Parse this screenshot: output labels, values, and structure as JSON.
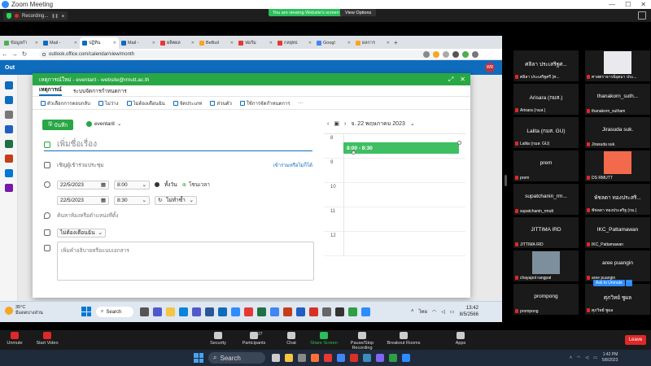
{
  "zoom": {
    "window_title": "Zoom Meeting",
    "recording_label": "Recording...",
    "share_banner": "You are viewing Website's screen",
    "view_options": "View Options",
    "controls": [
      {
        "label": "Unmute",
        "icon": "mic-muted-icon"
      },
      {
        "label": "Start Video",
        "icon": "video-off-icon"
      },
      {
        "label": "Security",
        "icon": "shield-icon"
      },
      {
        "label": "Participants",
        "icon": "participants-icon",
        "count": "27"
      },
      {
        "label": "Chat",
        "icon": "chat-icon"
      },
      {
        "label": "Share Screen",
        "icon": "share-screen-icon"
      },
      {
        "label": "Pause/Stop Recording",
        "icon": "record-icon"
      },
      {
        "label": "Breakout Rooms",
        "icon": "breakout-icon"
      },
      {
        "label": "Apps",
        "icon": "apps-icon"
      }
    ],
    "leave_label": "Leave",
    "ask_unmute": "Ask to Unmute",
    "ask_more": "···"
  },
  "participants": [
    {
      "name": "ศลิลา ประเสริฐศ...",
      "label": "ศลิลา ประเสริฐศรี (ศ...",
      "video": false
    },
    {
      "name": "",
      "label": "ศาสตราจารย์อุตมา ประ...",
      "video": true,
      "video_bg": "#e9e9ee"
    },
    {
      "name": "Arisara (กมส.)",
      "label": "Arisara (กมส.)",
      "video": false
    },
    {
      "name": "thanakorn_suth...",
      "label": "thanakorn_sutham",
      "video": false
    },
    {
      "name": "Lalita (กมส. GU)",
      "label": "Lalita (กมส. GU)",
      "video": false
    },
    {
      "name": "Jirasuda suk.",
      "label": "Jirasuda suk.",
      "video": false
    },
    {
      "name": "prem",
      "label": "prem",
      "video": false
    },
    {
      "name": "",
      "label": "DS RMUTT",
      "video": true,
      "video_bg": "#f26a4b"
    },
    {
      "name": "supatchanin_rm...",
      "label": "supatchanin_rmutt",
      "video": false
    },
    {
      "name": "พัชลดา ทองประสริ...",
      "label": "พัชลดา ทองประสริฐ (กม.)",
      "video": false
    },
    {
      "name": "JITTIMA IRD",
      "label": "JITTIMA IRD",
      "video": false
    },
    {
      "name": "IKC_Pattamawan",
      "label": "IKC_Pattamawan",
      "video": false
    },
    {
      "name": "",
      "label": "chayapol rangpat",
      "video": true,
      "video_bg": "#7d8f9c"
    },
    {
      "name": "aree puangin",
      "label": "aree puangin",
      "video": false
    },
    {
      "name": "prompong",
      "label": "prompong",
      "video": false
    },
    {
      "name": "ศุภวิทย์ ชูผล",
      "label": "ศุภวิทย์ ชูผล",
      "video": false
    }
  ],
  "browser": {
    "tabs": [
      {
        "label": "ข้อมูลกำ",
        "color": "#4caf50",
        "active": false
      },
      {
        "label": "Mail -",
        "color": "#0f6cbd",
        "active": false
      },
      {
        "label": "ปฏิทิน",
        "color": "#0f6cbd",
        "active": true
      },
      {
        "label": "Mail -",
        "color": "#0f6cbd",
        "active": false
      },
      {
        "label": "ผลิตผล",
        "color": "#e53935",
        "active": false
      },
      {
        "label": "BeBuil",
        "color": "#f5a623",
        "active": false
      },
      {
        "label": "ฟอร์ม",
        "color": "#e53935",
        "active": false
      },
      {
        "label": "กลยุทธ",
        "color": "#e53935",
        "active": false
      },
      {
        "label": "Googl",
        "color": "#4285f4",
        "active": false
      },
      {
        "label": "ผลการ",
        "color": "#f5a623",
        "active": false
      }
    ],
    "url": "outlook.office.com/calendar/view/month",
    "header_label": "Out",
    "avatar_initials": "WR"
  },
  "event": {
    "title_bar": "เหตุการณ์ใหม่ - eventarit - website@rmutt.ac.th",
    "tabs": [
      "เหตุการณ์",
      "ระบบจัดการกำหนดการ"
    ],
    "toolbar": [
      "ตัวเลือกการตอบกลับ",
      "ไม่ว่าง",
      "ไม่ต้องเตือนฉัน",
      "จัดประเภท",
      "ส่วนตัว",
      "ใช้การจัดกำหนดการ",
      "···"
    ],
    "save_label": "บันทึก",
    "calendar_name": "eventarit",
    "title_placeholder": "เพิ่มชื่อเรื่อง",
    "attendees_placeholder": "เชิญผู้เข้าร่วมประชุม",
    "attendees_optional": "เข้าร่วมหรือไม่ก็ได้",
    "start_date": "22/5/2023",
    "start_time": "8:00",
    "end_date": "22/5/2023",
    "end_time": "8:30",
    "all_day": "ทั้งวัน",
    "timezone": "โซนเวลา",
    "repeat": "ไม่ทำซ้ำ",
    "location_placeholder": "ค้นหาห้องหรือตำแหน่งที่ตั้ง",
    "reminder": "ไม่ต้องเตือนฉัน",
    "description_placeholder": "เพิ่มคำอธิบายหรือแนบเอกสาร"
  },
  "dayview": {
    "date_label": "จ. 22 พฤษภาคม 2023",
    "hours": [
      "8",
      "9",
      "10",
      "11",
      "12"
    ],
    "event_label": "8:00 - 8:30"
  },
  "shared_taskbar": {
    "weather_temp": "35°C",
    "weather_desc": "มีแดดบางส่วน",
    "search": "Search",
    "lang": "ไทย",
    "time": "13:42",
    "date": "8/5/2566"
  },
  "host_taskbar": {
    "search": "Search",
    "time": "1:42 PM",
    "date": "5/8/2023"
  }
}
